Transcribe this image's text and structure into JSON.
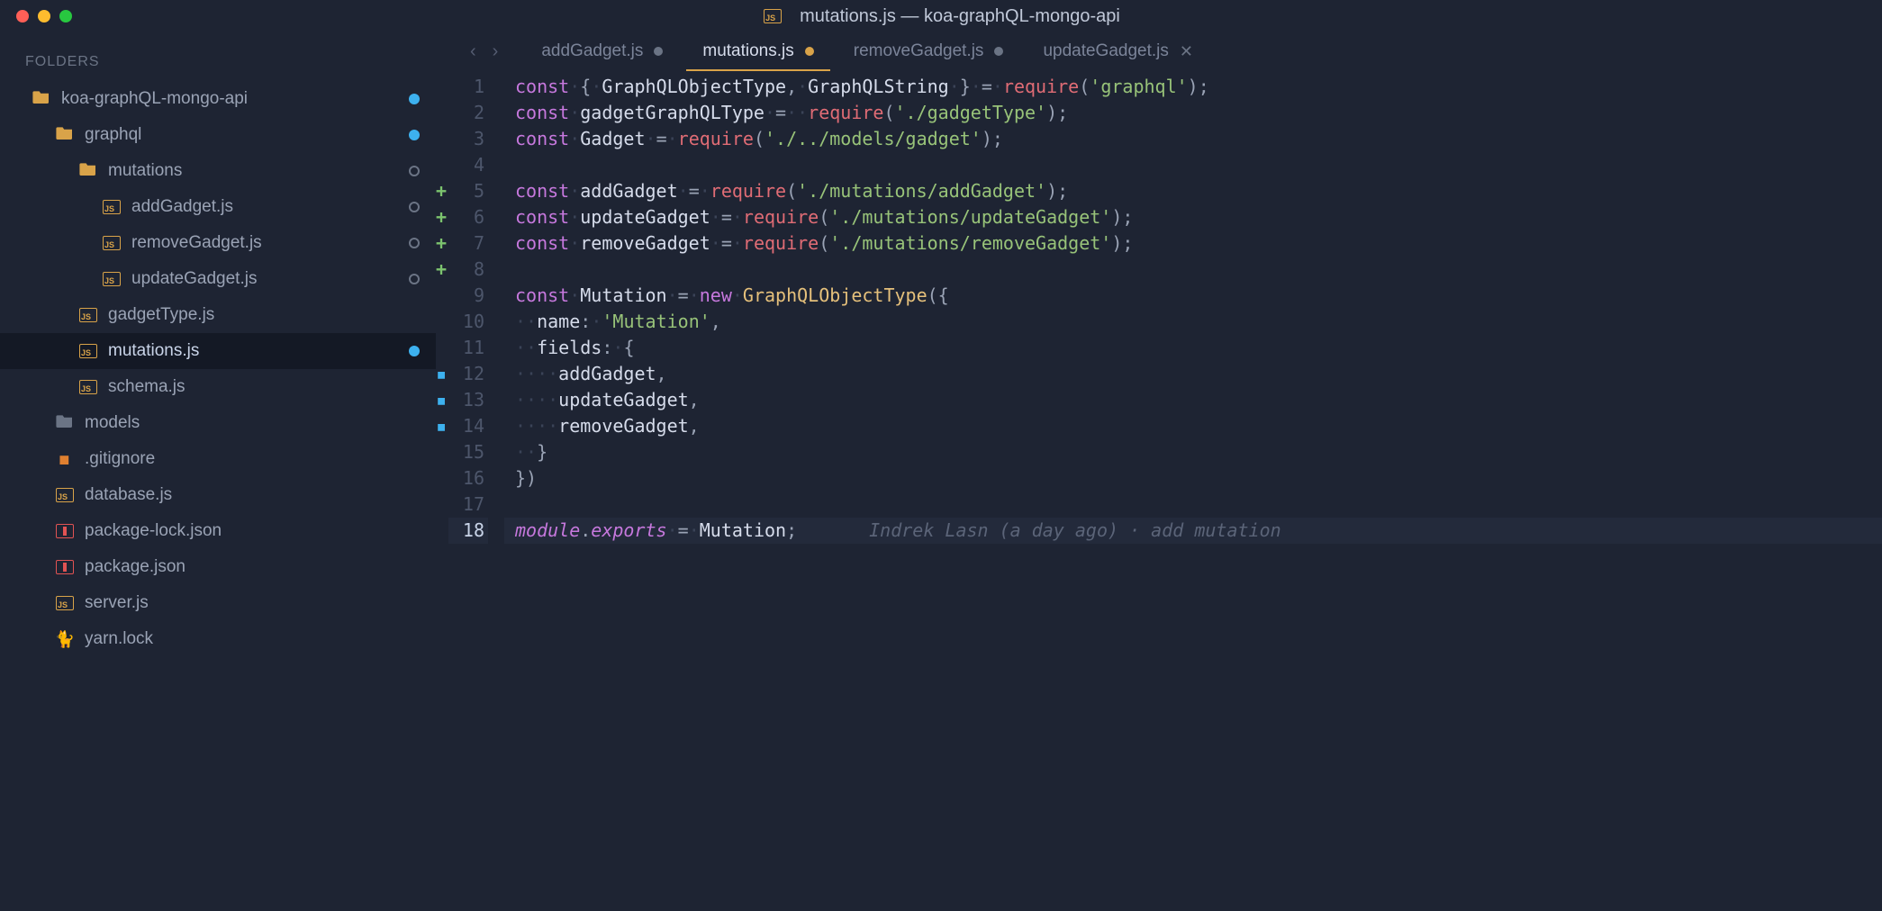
{
  "window": {
    "title": "mutations.js — koa-graphQL-mongo-api",
    "file_icon": "js-file-icon"
  },
  "sidebar": {
    "header": "FOLDERS",
    "tree": [
      {
        "icon": "folder-open-yellow",
        "label": "koa-graphQL-mongo-api",
        "indent": 0,
        "status": "filled-blue"
      },
      {
        "icon": "folder-open-yellow",
        "label": "graphql",
        "indent": 1,
        "status": "filled-blue"
      },
      {
        "icon": "folder-open-yellow",
        "label": "mutations",
        "indent": 2,
        "status": "hollow"
      },
      {
        "icon": "js",
        "label": "addGadget.js",
        "indent": 3,
        "status": "hollow"
      },
      {
        "icon": "js",
        "label": "removeGadget.js",
        "indent": 3,
        "status": "hollow"
      },
      {
        "icon": "js",
        "label": "updateGadget.js",
        "indent": 3,
        "status": "hollow"
      },
      {
        "icon": "js",
        "label": "gadgetType.js",
        "indent": 2,
        "status": ""
      },
      {
        "icon": "js",
        "label": "mutations.js",
        "indent": 2,
        "status": "filled-blue",
        "selected": true
      },
      {
        "icon": "js",
        "label": "schema.js",
        "indent": 2,
        "status": ""
      },
      {
        "icon": "folder-gray",
        "label": "models",
        "indent": 1,
        "status": ""
      },
      {
        "icon": "git",
        "label": ".gitignore",
        "indent": 1,
        "status": ""
      },
      {
        "icon": "js",
        "label": "database.js",
        "indent": 1,
        "status": ""
      },
      {
        "icon": "json",
        "label": "package-lock.json",
        "indent": 1,
        "status": ""
      },
      {
        "icon": "json",
        "label": "package.json",
        "indent": 1,
        "status": ""
      },
      {
        "icon": "js",
        "label": "server.js",
        "indent": 1,
        "status": ""
      },
      {
        "icon": "yarn",
        "label": "yarn.lock",
        "indent": 1,
        "status": ""
      }
    ]
  },
  "tabs": [
    {
      "label": "addGadget.js",
      "state": "gray"
    },
    {
      "label": "mutations.js",
      "state": "dirty",
      "active": true
    },
    {
      "label": "removeGadget.js",
      "state": "gray"
    },
    {
      "label": "updateGadget.js",
      "state": "close"
    }
  ],
  "code": {
    "lines": [
      {
        "n": 1,
        "bar": true,
        "html": "<span class='tok-kw'>const</span><span class='ws'>·</span><span class='tok-punc'>{</span><span class='ws'>·</span><span class='tok-name'>GraphQLObjectType</span><span class='tok-punc'>,</span><span class='ws'>·</span><span class='tok-name'>GraphQLString</span><span class='ws'>·</span><span class='tok-punc'>}</span><span class='ws'>·</span><span class='tok-punc'>=</span><span class='ws'>·</span><span class='tok-builtin'>require</span><span class='tok-punc'>(</span><span class='tok-str'>'graphql'</span><span class='tok-punc'>);</span>"
      },
      {
        "n": 2,
        "bar": true,
        "html": "<span class='tok-kw'>const</span><span class='ws'>·</span><span class='tok-name'>gadgetGraphQLType</span><span class='ws'>·</span><span class='tok-punc'>=</span><span class='ws'>··</span><span class='tok-builtin'>require</span><span class='tok-punc'>(</span><span class='tok-str'>'./gadgetType'</span><span class='tok-punc'>);</span>"
      },
      {
        "n": 3,
        "bar": true,
        "html": "<span class='tok-kw'>const</span><span class='ws'>·</span><span class='tok-name'>Gadget</span><span class='ws'>·</span><span class='tok-punc'>=</span><span class='ws'>·</span><span class='tok-builtin'>require</span><span class='tok-punc'>(</span><span class='tok-str'>'./../models/gadget'</span><span class='tok-punc'>);</span>"
      },
      {
        "n": 4,
        "bar": true,
        "html": ""
      },
      {
        "n": 5,
        "bar": true,
        "diff": "+",
        "html": "<span class='tok-kw'>const</span><span class='ws'>·</span><span class='tok-name'>addGadget</span><span class='ws'>·</span><span class='tok-punc'>=</span><span class='ws'>·</span><span class='tok-builtin'>require</span><span class='tok-punc'>(</span><span class='tok-str'>'./mutations/addGadget'</span><span class='tok-punc'>);</span>"
      },
      {
        "n": 6,
        "bar": true,
        "diff": "+",
        "html": "<span class='tok-kw'>const</span><span class='ws'>·</span><span class='tok-name'>updateGadget</span><span class='ws'>·</span><span class='tok-punc'>=</span><span class='ws'>·</span><span class='tok-builtin'>require</span><span class='tok-punc'>(</span><span class='tok-str'>'./mutations/updateGadget'</span><span class='tok-punc'>);</span>"
      },
      {
        "n": 7,
        "bar": true,
        "diff": "+",
        "html": "<span class='tok-kw'>const</span><span class='ws'>·</span><span class='tok-name'>removeGadget</span><span class='ws'>·</span><span class='tok-punc'>=</span><span class='ws'>·</span><span class='tok-builtin'>require</span><span class='tok-punc'>(</span><span class='tok-str'>'./mutations/removeGadget'</span><span class='tok-punc'>);</span>"
      },
      {
        "n": 8,
        "bar": true,
        "diff": "+",
        "html": ""
      },
      {
        "n": 9,
        "bar": true,
        "html": "<span class='tok-kw'>const</span><span class='ws'>·</span><span class='tok-name'>Mutation</span><span class='ws'>·</span><span class='tok-punc'>=</span><span class='ws'>·</span><span class='tok-kw'>new</span><span class='ws'>·</span><span class='tok-func'>GraphQLObjectType</span><span class='tok-punc'>({</span>"
      },
      {
        "n": 10,
        "bar": true,
        "html": "<span class='ws'>··</span><span class='tok-prop'>name</span><span class='tok-punc'>:</span><span class='ws'>·</span><span class='tok-str'>'Mutation'</span><span class='tok-punc'>,</span>"
      },
      {
        "n": 11,
        "bar": true,
        "html": "<span class='ws'>··</span><span class='tok-prop'>fields</span><span class='tok-punc'>:</span><span class='ws'>·</span><span class='tok-punc'>{</span>"
      },
      {
        "n": 12,
        "bar": true,
        "diff": "m",
        "html": "<span class='ws'>····</span><span class='tok-name'>addGadget</span><span class='tok-punc'>,</span>"
      },
      {
        "n": 13,
        "bar": true,
        "diff": "m",
        "html": "<span class='ws'>····</span><span class='tok-name'>updateGadget</span><span class='tok-punc'>,</span>"
      },
      {
        "n": 14,
        "bar": true,
        "diff": "m",
        "html": "<span class='ws'>····</span><span class='tok-name'>removeGadget</span><span class='tok-punc'>,</span>"
      },
      {
        "n": 15,
        "bar": true,
        "html": "<span class='ws'>··</span><span class='tok-punc'>}</span>"
      },
      {
        "n": 16,
        "bar": true,
        "html": "<span class='tok-punc'>})</span>"
      },
      {
        "n": 17,
        "bar": true,
        "html": ""
      },
      {
        "n": 18,
        "current": true,
        "html": "<span class='tok-kw2'>module</span><span class='tok-punc'>.</span><span class='tok-kw2'>exports</span><span class='ws'>·</span><span class='tok-punc'>=</span><span class='ws'>·</span><span class='tok-name'>Mutation</span><span class='tok-punc'>;</span><span class='blame'>Indrek Lasn (a day ago) · add mutation</span>"
      }
    ]
  }
}
